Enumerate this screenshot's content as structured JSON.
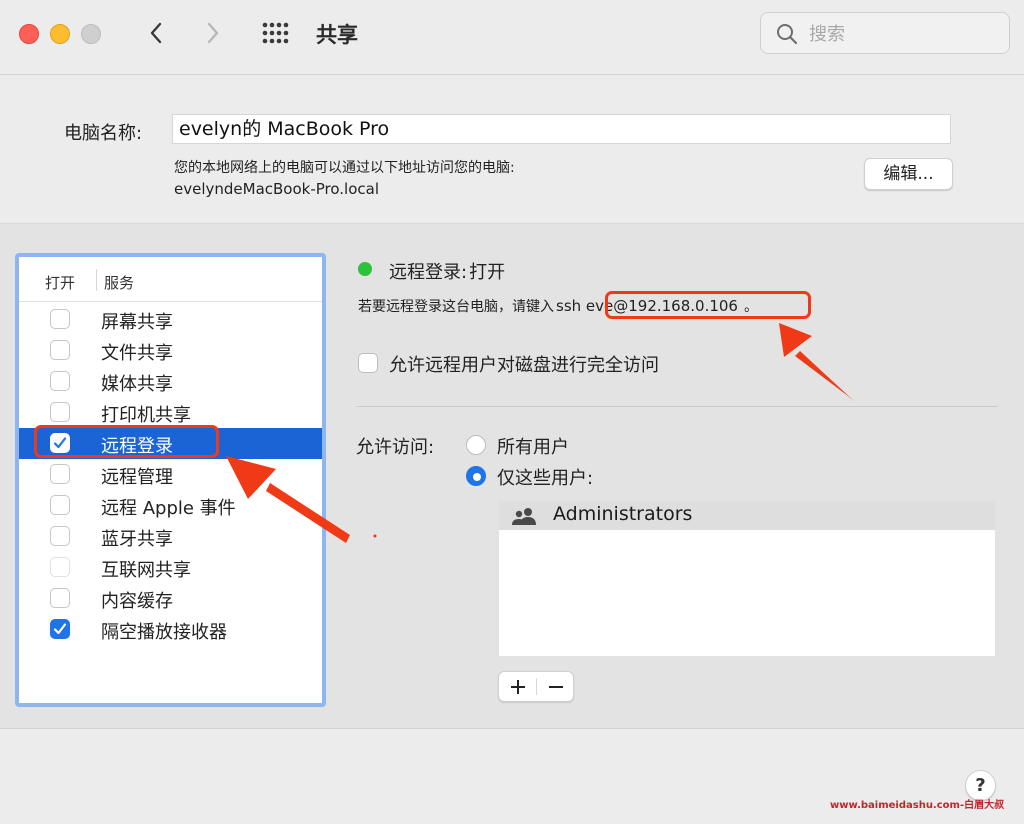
{
  "toolbar": {
    "title": "共享",
    "search_placeholder": "搜索"
  },
  "computer_name": {
    "label": "电脑名称:",
    "value": "evelyn的 MacBook Pro",
    "description": "您的本地网络上的电脑可以通过以下地址访问您的电脑:",
    "hostname": "evelyndeMacBook-Pro.local",
    "edit_label": "编辑..."
  },
  "services": {
    "header_on": "打开",
    "header_service": "服务",
    "items": [
      {
        "label": "屏幕共享",
        "checked": false,
        "selected": false
      },
      {
        "label": "文件共享",
        "checked": false,
        "selected": false
      },
      {
        "label": "媒体共享",
        "checked": false,
        "selected": false
      },
      {
        "label": "打印机共享",
        "checked": false,
        "selected": false
      },
      {
        "label": "远程登录",
        "checked": true,
        "selected": true
      },
      {
        "label": "远程管理",
        "checked": false,
        "selected": false
      },
      {
        "label": "远程 Apple 事件",
        "checked": false,
        "selected": false
      },
      {
        "label": "蓝牙共享",
        "checked": false,
        "selected": false
      },
      {
        "label": "互联网共享",
        "checked": false,
        "selected": false
      },
      {
        "label": "内容缓存",
        "checked": false,
        "selected": false
      },
      {
        "label": "隔空播放接收器",
        "checked": true,
        "selected": false
      }
    ]
  },
  "details": {
    "status_prefix": "远程登录:",
    "status_value": "打开",
    "status_color": "#2cc23c",
    "hint_prefix": "若要远程登录这台电脑，请键入",
    "ssh_command": "ssh eve@192.168.0.106",
    "hint_suffix": "。",
    "full_access_label": "允许远程用户对磁盘进行完全访问",
    "full_access_checked": false,
    "allow_label": "允许访问:",
    "radio_all": "所有用户",
    "radio_only": "仅这些用户:",
    "selected_radio": "仅这些用户:",
    "users": [
      "Administrators"
    ],
    "add_label": "+",
    "remove_label": "−"
  },
  "help_label": "?",
  "watermark": "www.baimeidashu.com-白眉大叔",
  "colors": {
    "accent": "#1f74e8",
    "selection": "#1a64d6",
    "annotation": "#f03a17",
    "panel_focus": "#8db5ef"
  }
}
